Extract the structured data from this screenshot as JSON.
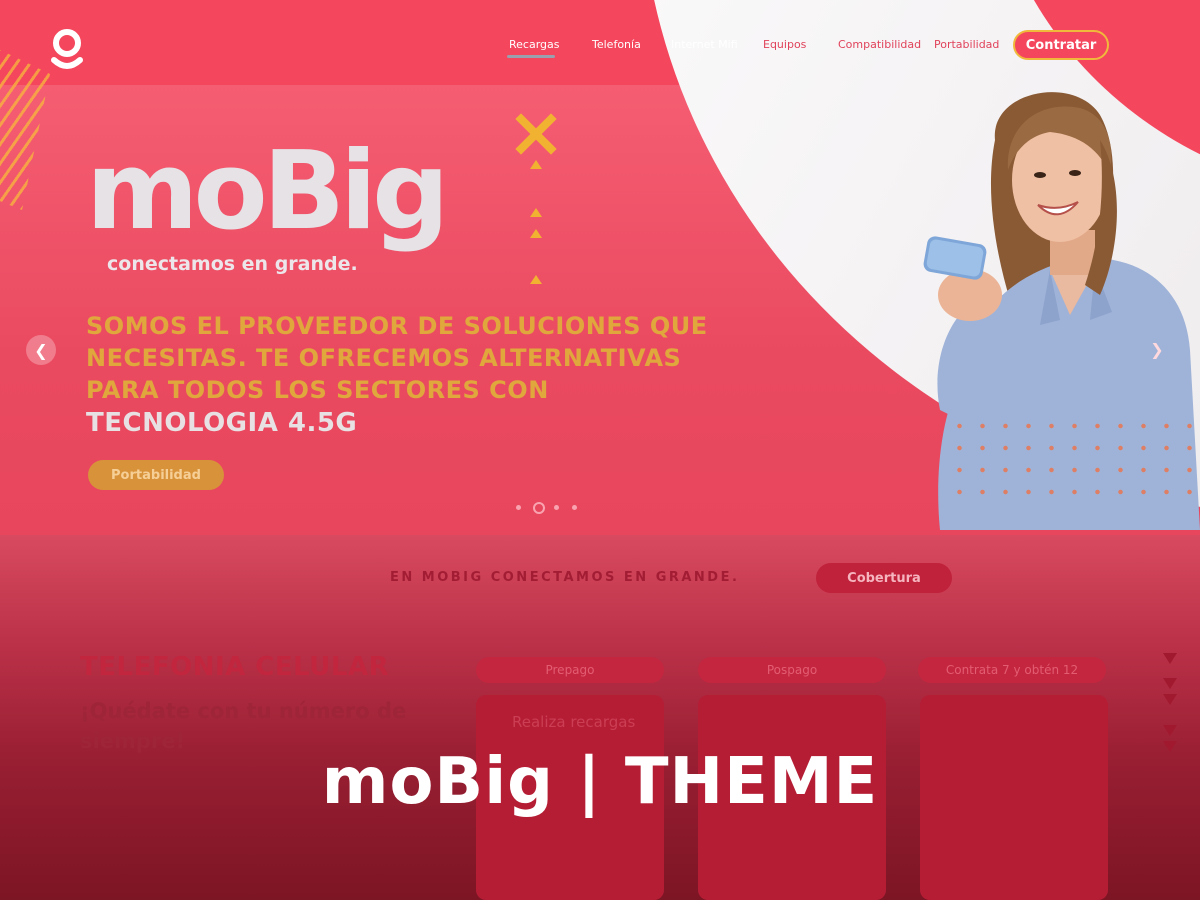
{
  "header": {
    "logo_icon": "mobig-logo-icon",
    "nav": [
      {
        "label": "Recargas",
        "active": true
      },
      {
        "label": "Telefonía"
      },
      {
        "label": "Internet Mifi"
      },
      {
        "label": "Equipos"
      },
      {
        "label": "Compatibilidad"
      },
      {
        "label": "Portabilidad"
      }
    ],
    "cta_label": "Contratar"
  },
  "hero": {
    "brand": "moBig",
    "tagline": "conectamos en grande.",
    "headline": "SOMOS EL PROVEEDOR DE SOLUCIONES QUE NECESITAS. TE OFRECEMOS ALTERNATIVAS PARA TODOS LOS SECTORES CON",
    "headline_highlight": "TECNOLOGIA 4.5G",
    "button_label": "Portabilidad",
    "prev_icon": "chevron-left-icon",
    "next_icon": "chevron-right-icon",
    "slides_count": 4,
    "active_slide": 2
  },
  "coverage": {
    "tagline": "EN MOBIG CONECTAMOS EN GRANDE.",
    "button_label": "Cobertura"
  },
  "plans": {
    "title": "TELEFONIA CELULAR",
    "subtitle": "¡Quédate con tu número de siempre!",
    "tabs": [
      "Prepago",
      "Pospago",
      "Contrata 7 y obtén 12"
    ],
    "card_text": "Realiza recargas"
  },
  "overlay_title": "moBig | THEME",
  "colors": {
    "brand_red": "#f4465d",
    "accent_yellow": "#f0b93b",
    "accent_orange": "#d8923a",
    "dark_red": "#7c1524"
  }
}
